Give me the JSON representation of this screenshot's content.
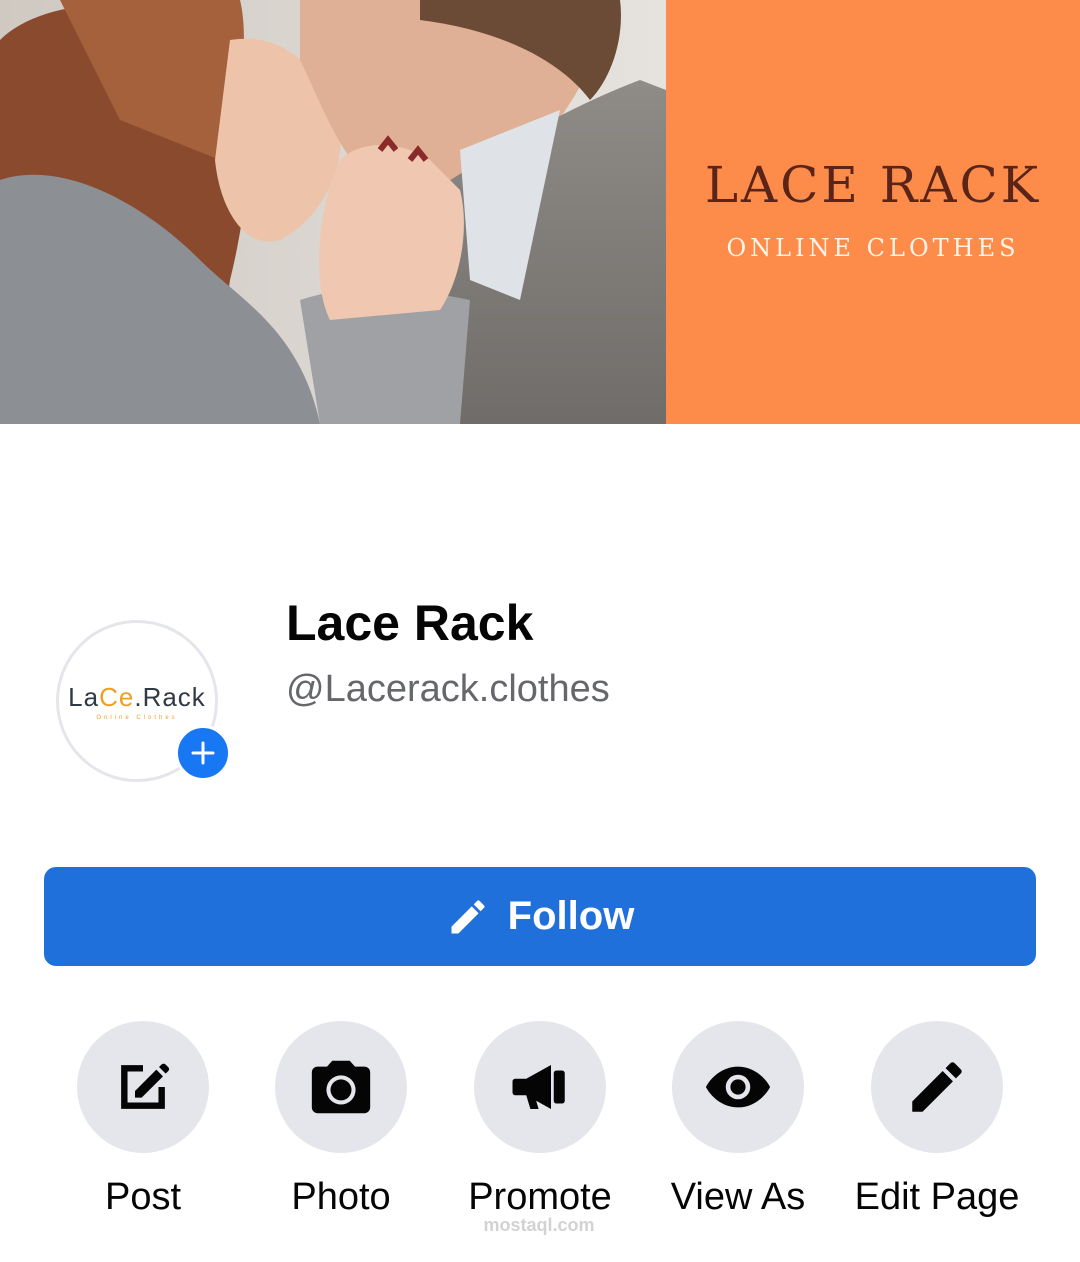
{
  "cover": {
    "brand_title": "LACE RACK",
    "brand_subtitle": "ONLINE CLOTHES",
    "banner_color": "#fd8c4b"
  },
  "profile": {
    "avatar_logo_a": "La",
    "avatar_logo_c": "Ce",
    "avatar_logo_b": ".Rack",
    "avatar_tagline": "Online Clothes",
    "page_name": "Lace Rack",
    "handle": "@Lacerack.clothes"
  },
  "follow_button": {
    "label": "Follow",
    "icon": "pencil-icon",
    "color": "#2070dc"
  },
  "actions": [
    {
      "label": "Post",
      "icon": "edit-square-icon"
    },
    {
      "label": "Photo",
      "icon": "camera-icon"
    },
    {
      "label": "Promote",
      "icon": "megaphone-icon"
    },
    {
      "label": "View As",
      "icon": "eye-icon"
    },
    {
      "label": "Edit Page",
      "icon": "pencil-icon"
    }
  ],
  "watermark": "mostaql.com"
}
